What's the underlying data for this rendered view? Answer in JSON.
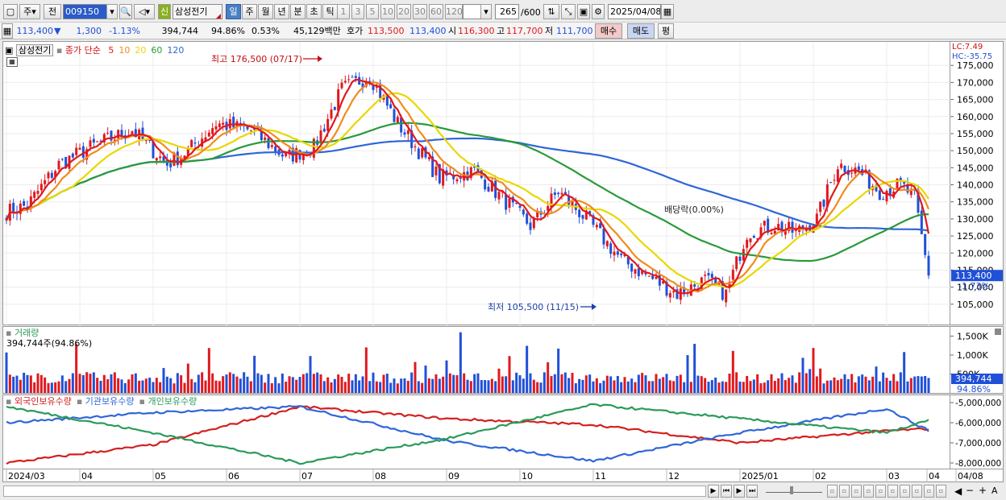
{
  "toolbar": {
    "kind": "주",
    "mode": "전",
    "code": "009150",
    "name_badge": "신",
    "name": "삼성전기",
    "periods": [
      "일",
      "주",
      "월",
      "년",
      "분",
      "초",
      "틱"
    ],
    "active_period": "일",
    "minutes": [
      "1",
      "3",
      "5",
      "10",
      "20",
      "30",
      "60",
      "120"
    ],
    "count": "265",
    "count_total": "/600",
    "date": "2025/04/08"
  },
  "quote": {
    "price": "113,400",
    "arrow": "▼",
    "change": "1,300",
    "pct": "-1.13%",
    "volume": "394,744",
    "vol_ratio": "94.86%",
    "turnover": "0.53%",
    "amount_label": "45,129백만",
    "bid_label": "호가",
    "bid": "113,500",
    "ask": "113,400",
    "open_label": "시",
    "open": "116,300",
    "high_label": "고",
    "high": "117,700",
    "low_label": "저",
    "low": "111,700",
    "buy_btn": "매수",
    "sell_btn": "매도",
    "eval_btn": "평"
  },
  "price_pane": {
    "stock_tag": "삼성전기",
    "indicator_label": "종가 단순",
    "ma": [
      {
        "label": "5",
        "color": "#e0191e"
      },
      {
        "label": "10",
        "color": "#f08c1c"
      },
      {
        "label": "20",
        "color": "#e8d800"
      },
      {
        "label": "60",
        "color": "#2a9a3a"
      },
      {
        "label": "120",
        "color": "#2f66d8"
      }
    ],
    "lc_label": "LC:7.49",
    "hc_label": "HC:-35.75",
    "high_note": "최고 176,500 (07/17)",
    "low_note": "최저 105,500 (11/15)",
    "div_note": "배당락(0.00%)",
    "last_price": "113,400",
    "last_pct": "-1.73%"
  },
  "volume_pane": {
    "title": "거래량",
    "sub": "394,744주(94.86%)",
    "ticks": [
      "1,500K",
      "1,000K",
      "500K"
    ],
    "last": "394,744",
    "last_pct": "94.86%"
  },
  "holding_pane": {
    "legend": [
      {
        "label": "외국인보유수량",
        "color": "#d42020"
      },
      {
        "label": "기관보유수량",
        "color": "#2f66d8"
      },
      {
        "label": "개인보유수량",
        "color": "#2a9a5a"
      }
    ],
    "ticks": [
      "-5,000,000",
      "-6,000,000",
      "-7,000,000",
      "-8,000,000"
    ]
  },
  "xaxis": {
    "labels": [
      "2024/03",
      "04",
      "05",
      "06",
      "07",
      "08",
      "09",
      "10",
      "11",
      "12",
      "2025/01",
      "02",
      "03",
      "04",
      "04/08"
    ]
  },
  "colors": {
    "up": "#e0191e",
    "down": "#2050d8",
    "ma5": "#e0191e",
    "ma10": "#f08c1c",
    "ma20": "#e8d800",
    "ma60": "#2a9a3a",
    "ma120": "#2f66d8"
  },
  "chart_data": [
    {
      "type": "candlestick",
      "title": "삼성전기",
      "ylim": [
        100000,
        180000
      ],
      "y_ticks": [
        105000,
        110000,
        115000,
        120000,
        125000,
        130000,
        135000,
        140000,
        145000,
        150000,
        155000,
        160000,
        165000,
        170000,
        175000
      ],
      "close_monthly": {
        "x": [
          "2024/03",
          "2024/04",
          "2024/05",
          "2024/06",
          "2024/07",
          "2024/08",
          "2024/09",
          "2024/10",
          "2024/11",
          "2024/12",
          "2025/01",
          "2025/02",
          "2025/03",
          "2025/04"
        ],
        "values": [
          132000,
          154000,
          151000,
          156000,
          168000,
          144000,
          130000,
          121000,
          108000,
          127000,
          128000,
          145000,
          139000,
          113400
        ]
      },
      "ma_120_approx": {
        "x": [
          "2024/03",
          "2024/05",
          "2024/07",
          "2024/09",
          "2024/11",
          "2025/01",
          "2025/03",
          "2025/04"
        ],
        "values": [
          141000,
          143000,
          146000,
          151000,
          141000,
          127000,
          126500,
          126000
        ]
      },
      "ma_60_approx": {
        "x": [
          "2024/03",
          "2024/05",
          "2024/07",
          "2024/09",
          "2024/11",
          "2025/01",
          "2025/03",
          "2025/04"
        ],
        "values": [
          144000,
          144000,
          154000,
          149000,
          125000,
          120000,
          133000,
          134000
        ]
      },
      "annotations": [
        "최고 176,500 (07/17)",
        "최저 105,500 (11/15)",
        "배당락(0.00%)"
      ]
    },
    {
      "type": "bar",
      "title": "거래량",
      "ylim": [
        0,
        1700000
      ],
      "last_value": 394744
    },
    {
      "type": "line",
      "title": "보유수량",
      "ylim": [
        -8200000,
        -4800000
      ],
      "series": [
        {
          "name": "외국인보유수량",
          "x": [
            "2024/03",
            "2024/05",
            "2024/07",
            "2024/09",
            "2024/11",
            "2025/01",
            "2025/03",
            "2025/04"
          ],
          "values": [
            -8000000,
            -7100000,
            -5200000,
            -5800000,
            -6100000,
            -7000000,
            -6400000,
            -6300000
          ]
        },
        {
          "name": "기관보유수량",
          "x": [
            "2024/03",
            "2024/05",
            "2024/07",
            "2024/09",
            "2024/11",
            "2025/01",
            "2025/03",
            "2025/04"
          ],
          "values": [
            -6000000,
            -5500000,
            -5200000,
            -6900000,
            -7900000,
            -6500000,
            -5300000,
            -6400000
          ]
        },
        {
          "name": "개인보유수량",
          "x": [
            "2024/03",
            "2024/05",
            "2024/07",
            "2024/09",
            "2024/11",
            "2025/01",
            "2025/03",
            "2025/04"
          ],
          "values": [
            -5200000,
            -6500000,
            -8000000,
            -6800000,
            -5100000,
            -5800000,
            -6500000,
            -5900000
          ]
        }
      ]
    }
  ]
}
